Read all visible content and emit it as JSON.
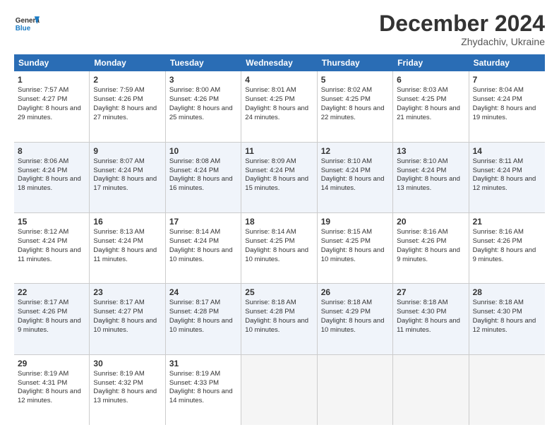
{
  "header": {
    "logo_general": "General",
    "logo_blue": "Blue",
    "month_title": "December 2024",
    "subtitle": "Zhydachiv, Ukraine"
  },
  "days": [
    "Sunday",
    "Monday",
    "Tuesday",
    "Wednesday",
    "Thursday",
    "Friday",
    "Saturday"
  ],
  "weeks": [
    [
      {
        "day": "1",
        "sunrise": "Sunrise: 7:57 AM",
        "sunset": "Sunset: 4:27 PM",
        "daylight": "Daylight: 8 hours and 29 minutes."
      },
      {
        "day": "2",
        "sunrise": "Sunrise: 7:59 AM",
        "sunset": "Sunset: 4:26 PM",
        "daylight": "Daylight: 8 hours and 27 minutes."
      },
      {
        "day": "3",
        "sunrise": "Sunrise: 8:00 AM",
        "sunset": "Sunset: 4:26 PM",
        "daylight": "Daylight: 8 hours and 25 minutes."
      },
      {
        "day": "4",
        "sunrise": "Sunrise: 8:01 AM",
        "sunset": "Sunset: 4:25 PM",
        "daylight": "Daylight: 8 hours and 24 minutes."
      },
      {
        "day": "5",
        "sunrise": "Sunrise: 8:02 AM",
        "sunset": "Sunset: 4:25 PM",
        "daylight": "Daylight: 8 hours and 22 minutes."
      },
      {
        "day": "6",
        "sunrise": "Sunrise: 8:03 AM",
        "sunset": "Sunset: 4:25 PM",
        "daylight": "Daylight: 8 hours and 21 minutes."
      },
      {
        "day": "7",
        "sunrise": "Sunrise: 8:04 AM",
        "sunset": "Sunset: 4:24 PM",
        "daylight": "Daylight: 8 hours and 19 minutes."
      }
    ],
    [
      {
        "day": "8",
        "sunrise": "Sunrise: 8:06 AM",
        "sunset": "Sunset: 4:24 PM",
        "daylight": "Daylight: 8 hours and 18 minutes."
      },
      {
        "day": "9",
        "sunrise": "Sunrise: 8:07 AM",
        "sunset": "Sunset: 4:24 PM",
        "daylight": "Daylight: 8 hours and 17 minutes."
      },
      {
        "day": "10",
        "sunrise": "Sunrise: 8:08 AM",
        "sunset": "Sunset: 4:24 PM",
        "daylight": "Daylight: 8 hours and 16 minutes."
      },
      {
        "day": "11",
        "sunrise": "Sunrise: 8:09 AM",
        "sunset": "Sunset: 4:24 PM",
        "daylight": "Daylight: 8 hours and 15 minutes."
      },
      {
        "day": "12",
        "sunrise": "Sunrise: 8:10 AM",
        "sunset": "Sunset: 4:24 PM",
        "daylight": "Daylight: 8 hours and 14 minutes."
      },
      {
        "day": "13",
        "sunrise": "Sunrise: 8:10 AM",
        "sunset": "Sunset: 4:24 PM",
        "daylight": "Daylight: 8 hours and 13 minutes."
      },
      {
        "day": "14",
        "sunrise": "Sunrise: 8:11 AM",
        "sunset": "Sunset: 4:24 PM",
        "daylight": "Daylight: 8 hours and 12 minutes."
      }
    ],
    [
      {
        "day": "15",
        "sunrise": "Sunrise: 8:12 AM",
        "sunset": "Sunset: 4:24 PM",
        "daylight": "Daylight: 8 hours and 11 minutes."
      },
      {
        "day": "16",
        "sunrise": "Sunrise: 8:13 AM",
        "sunset": "Sunset: 4:24 PM",
        "daylight": "Daylight: 8 hours and 11 minutes."
      },
      {
        "day": "17",
        "sunrise": "Sunrise: 8:14 AM",
        "sunset": "Sunset: 4:24 PM",
        "daylight": "Daylight: 8 hours and 10 minutes."
      },
      {
        "day": "18",
        "sunrise": "Sunrise: 8:14 AM",
        "sunset": "Sunset: 4:25 PM",
        "daylight": "Daylight: 8 hours and 10 minutes."
      },
      {
        "day": "19",
        "sunrise": "Sunrise: 8:15 AM",
        "sunset": "Sunset: 4:25 PM",
        "daylight": "Daylight: 8 hours and 10 minutes."
      },
      {
        "day": "20",
        "sunrise": "Sunrise: 8:16 AM",
        "sunset": "Sunset: 4:26 PM",
        "daylight": "Daylight: 8 hours and 9 minutes."
      },
      {
        "day": "21",
        "sunrise": "Sunrise: 8:16 AM",
        "sunset": "Sunset: 4:26 PM",
        "daylight": "Daylight: 8 hours and 9 minutes."
      }
    ],
    [
      {
        "day": "22",
        "sunrise": "Sunrise: 8:17 AM",
        "sunset": "Sunset: 4:26 PM",
        "daylight": "Daylight: 8 hours and 9 minutes."
      },
      {
        "day": "23",
        "sunrise": "Sunrise: 8:17 AM",
        "sunset": "Sunset: 4:27 PM",
        "daylight": "Daylight: 8 hours and 10 minutes."
      },
      {
        "day": "24",
        "sunrise": "Sunrise: 8:17 AM",
        "sunset": "Sunset: 4:28 PM",
        "daylight": "Daylight: 8 hours and 10 minutes."
      },
      {
        "day": "25",
        "sunrise": "Sunrise: 8:18 AM",
        "sunset": "Sunset: 4:28 PM",
        "daylight": "Daylight: 8 hours and 10 minutes."
      },
      {
        "day": "26",
        "sunrise": "Sunrise: 8:18 AM",
        "sunset": "Sunset: 4:29 PM",
        "daylight": "Daylight: 8 hours and 10 minutes."
      },
      {
        "day": "27",
        "sunrise": "Sunrise: 8:18 AM",
        "sunset": "Sunset: 4:30 PM",
        "daylight": "Daylight: 8 hours and 11 minutes."
      },
      {
        "day": "28",
        "sunrise": "Sunrise: 8:18 AM",
        "sunset": "Sunset: 4:30 PM",
        "daylight": "Daylight: 8 hours and 12 minutes."
      }
    ],
    [
      {
        "day": "29",
        "sunrise": "Sunrise: 8:19 AM",
        "sunset": "Sunset: 4:31 PM",
        "daylight": "Daylight: 8 hours and 12 minutes."
      },
      {
        "day": "30",
        "sunrise": "Sunrise: 8:19 AM",
        "sunset": "Sunset: 4:32 PM",
        "daylight": "Daylight: 8 hours and 13 minutes."
      },
      {
        "day": "31",
        "sunrise": "Sunrise: 8:19 AM",
        "sunset": "Sunset: 4:33 PM",
        "daylight": "Daylight: 8 hours and 14 minutes."
      },
      null,
      null,
      null,
      null
    ]
  ]
}
